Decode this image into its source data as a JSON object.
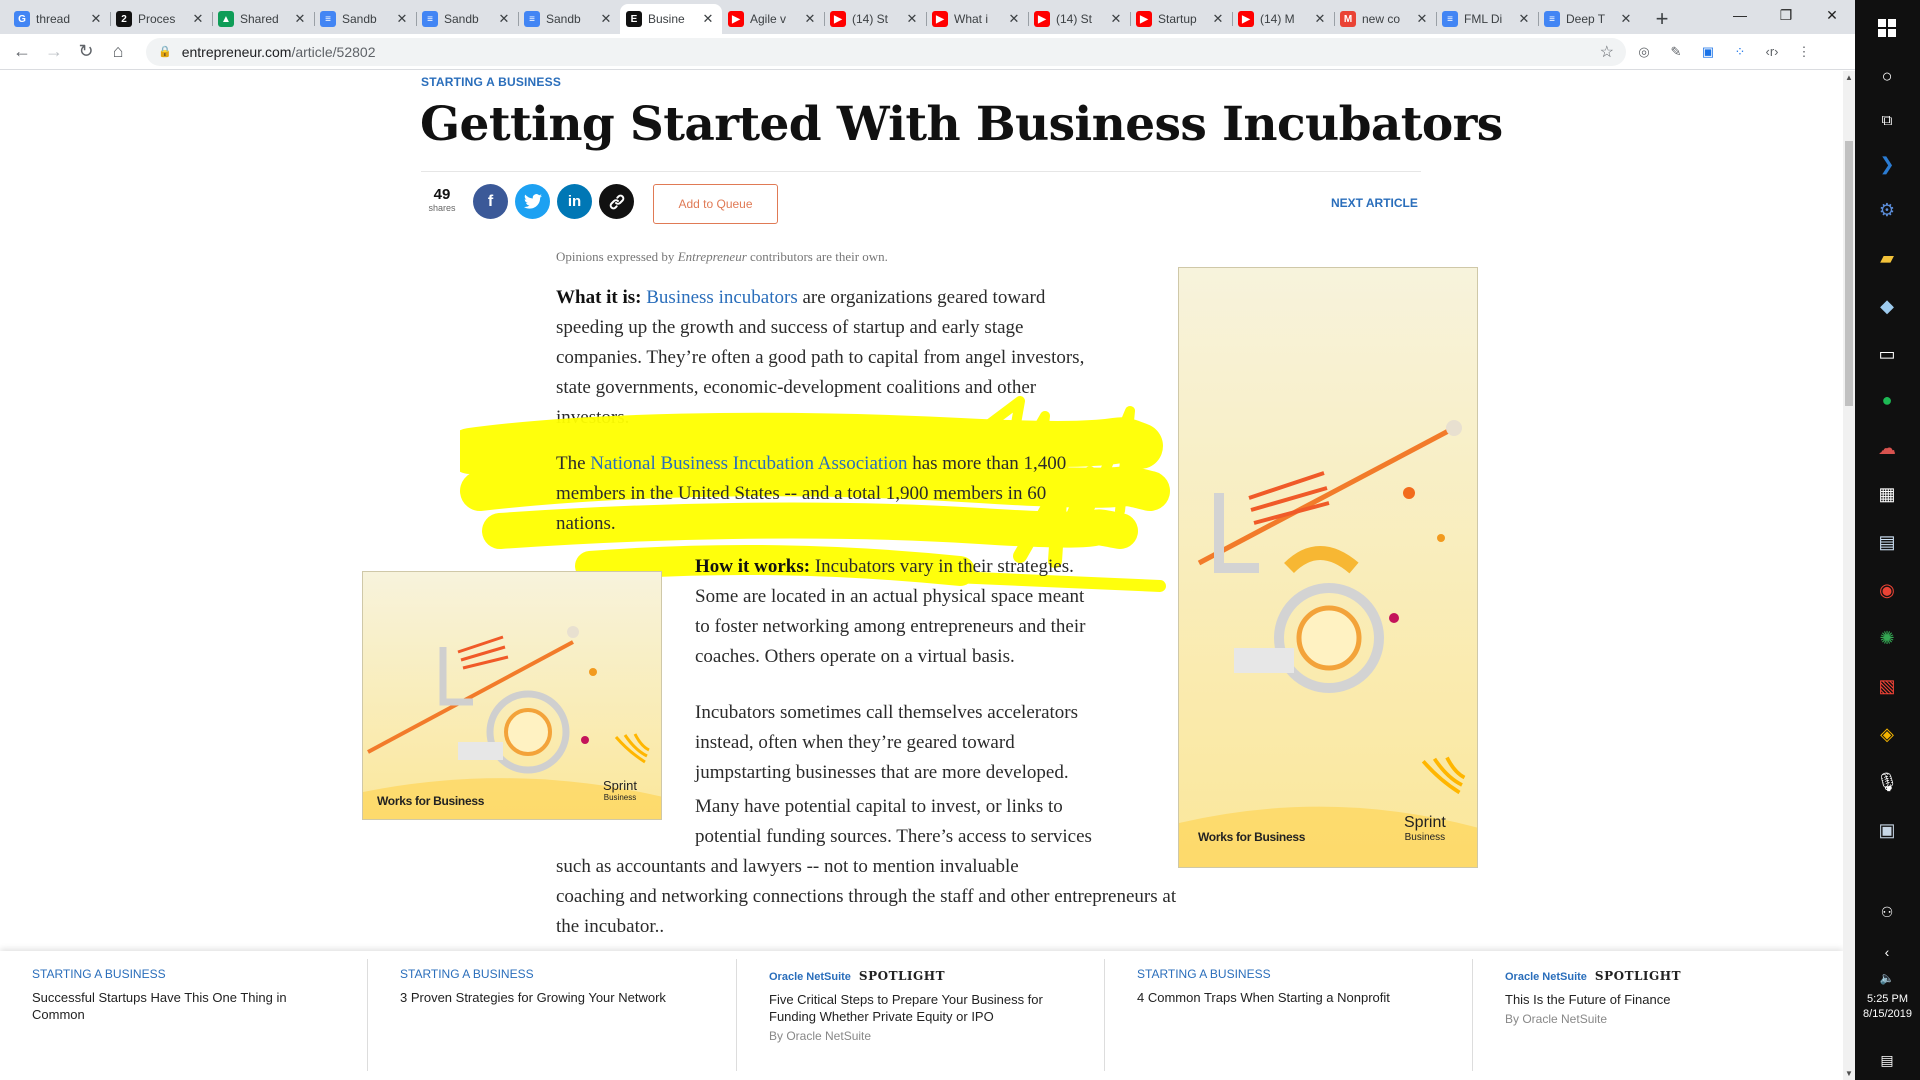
{
  "browser": {
    "tabs": [
      {
        "label": "thread",
        "favicon_color": "#4285f4",
        "favicon_text": "G",
        "active": false
      },
      {
        "label": "Proces",
        "favicon_color": "#111111",
        "favicon_text": "2",
        "active": false
      },
      {
        "label": "Shared",
        "favicon_color": "#0f9d58",
        "favicon_text": "▲",
        "active": false
      },
      {
        "label": "Sandb",
        "favicon_color": "#4285f4",
        "favicon_text": "≡",
        "active": false
      },
      {
        "label": "Sandb",
        "favicon_color": "#4285f4",
        "favicon_text": "≡",
        "active": false
      },
      {
        "label": "Sandb",
        "favicon_color": "#4285f4",
        "favicon_text": "≡",
        "active": false
      },
      {
        "label": "Busine",
        "favicon_color": "#111111",
        "favicon_text": "E",
        "active": true
      },
      {
        "label": "Agile v",
        "favicon_color": "#ff0000",
        "favicon_text": "▶",
        "active": false
      },
      {
        "label": "(14) St",
        "favicon_color": "#ff0000",
        "favicon_text": "▶",
        "active": false
      },
      {
        "label": "What i",
        "favicon_color": "#ff0000",
        "favicon_text": "▶",
        "active": false
      },
      {
        "label": "(14) St",
        "favicon_color": "#ff0000",
        "favicon_text": "▶",
        "active": false
      },
      {
        "label": "Startup",
        "favicon_color": "#ff0000",
        "favicon_text": "▶",
        "active": false
      },
      {
        "label": "(14) M",
        "favicon_color": "#ff0000",
        "favicon_text": "▶",
        "active": false
      },
      {
        "label": "new co",
        "favicon_color": "#ea4335",
        "favicon_text": "M",
        "active": false
      },
      {
        "label": "FML Di",
        "favicon_color": "#4285f4",
        "favicon_text": "≡",
        "active": false
      },
      {
        "label": "Deep T",
        "favicon_color": "#4285f4",
        "favicon_text": "≡",
        "active": false
      }
    ],
    "url_host": "entrepreneur.com",
    "url_path": "/article/52802"
  },
  "article": {
    "kicker": "STARTING A BUSINESS",
    "title": "Getting Started With Business Incubators",
    "shares_count": "49",
    "shares_label": "shares",
    "queue_label": "Add to Queue",
    "next_label": "NEXT ARTICLE",
    "disclaimer_pre": "Opinions expressed by ",
    "disclaimer_em": "Entrepreneur",
    "disclaimer_post": " contributors are their own.",
    "p1_label": "What it is:",
    "p1_link": "Business incubators",
    "p1_line1_rest": " are organizations geared toward",
    "p1_line2": "speeding up the growth and success of startup and early stage",
    "p1_line3": "companies. They’re often a good path to capital from angel investors,",
    "p1_line4": "state governments, economic-development coalitions and other",
    "p1_line5": "investors.",
    "p2_pre": "The ",
    "p2_link": "National Business Incubation Association",
    "p2_line1_rest": " has more than 1,400",
    "p2_line2": "members in the United States -- and a total 1,900 members in 60",
    "p2_line3": "nations.",
    "p3_label": "How it works:",
    "p3_line1_rest": " Incubators vary in their strategies.",
    "p3_line2": "Some are located in an actual physical space meant",
    "p3_line3": "to foster networking among entrepreneurs and their",
    "p3_line4": "coaches. Others operate on a virtual basis.",
    "p4_line1": "Incubators sometimes call themselves accelerators",
    "p4_line2": "instead, often when they’re geared toward",
    "p4_line3": "jumpstarting businesses that are more developed.",
    "p5_line1": "Many have potential capital to invest, or links to",
    "p5_line2": "potential funding sources. There’s access to services",
    "p5_line3": "such as accountants and lawyers -- not to mention invaluable",
    "p5_line4": "coaching and networking connections through the staff and other entrepreneurs at",
    "p5_line5": "the incubator.."
  },
  "ads": {
    "tagline": "Works for Business",
    "brand": "Sprint",
    "brand_sub": "Business"
  },
  "recommended": [
    {
      "kicker": "STARTING A BUSINESS",
      "title": "Successful Startups Have This One Thing in Common"
    },
    {
      "kicker": "STARTING A BUSINESS",
      "title": "3 Proven Strategies for Growing Your Network"
    },
    {
      "sponsor": "Oracle NetSuite",
      "spotlight": "SPOTLIGHT",
      "title": "Five Critical Steps to Prepare Your Business for Funding Whether Private Equity or IPO",
      "byline": "By Oracle NetSuite"
    },
    {
      "kicker": "STARTING A BUSINESS",
      "title": "4 Common Traps When Starting a Nonprofit"
    },
    {
      "sponsor": "Oracle NetSuite",
      "spotlight": "SPOTLIGHT",
      "title": "This Is the Future of Finance",
      "byline": "By Oracle NetSuite"
    }
  ],
  "taskbar": {
    "time": "5:25 PM",
    "date": "8/15/2019"
  },
  "colors": {
    "link": "#2a6ebb",
    "facebook": "#3b5998",
    "twitter": "#1da1f2",
    "linkedin": "#0077b5",
    "highlight": "#ffff00"
  }
}
